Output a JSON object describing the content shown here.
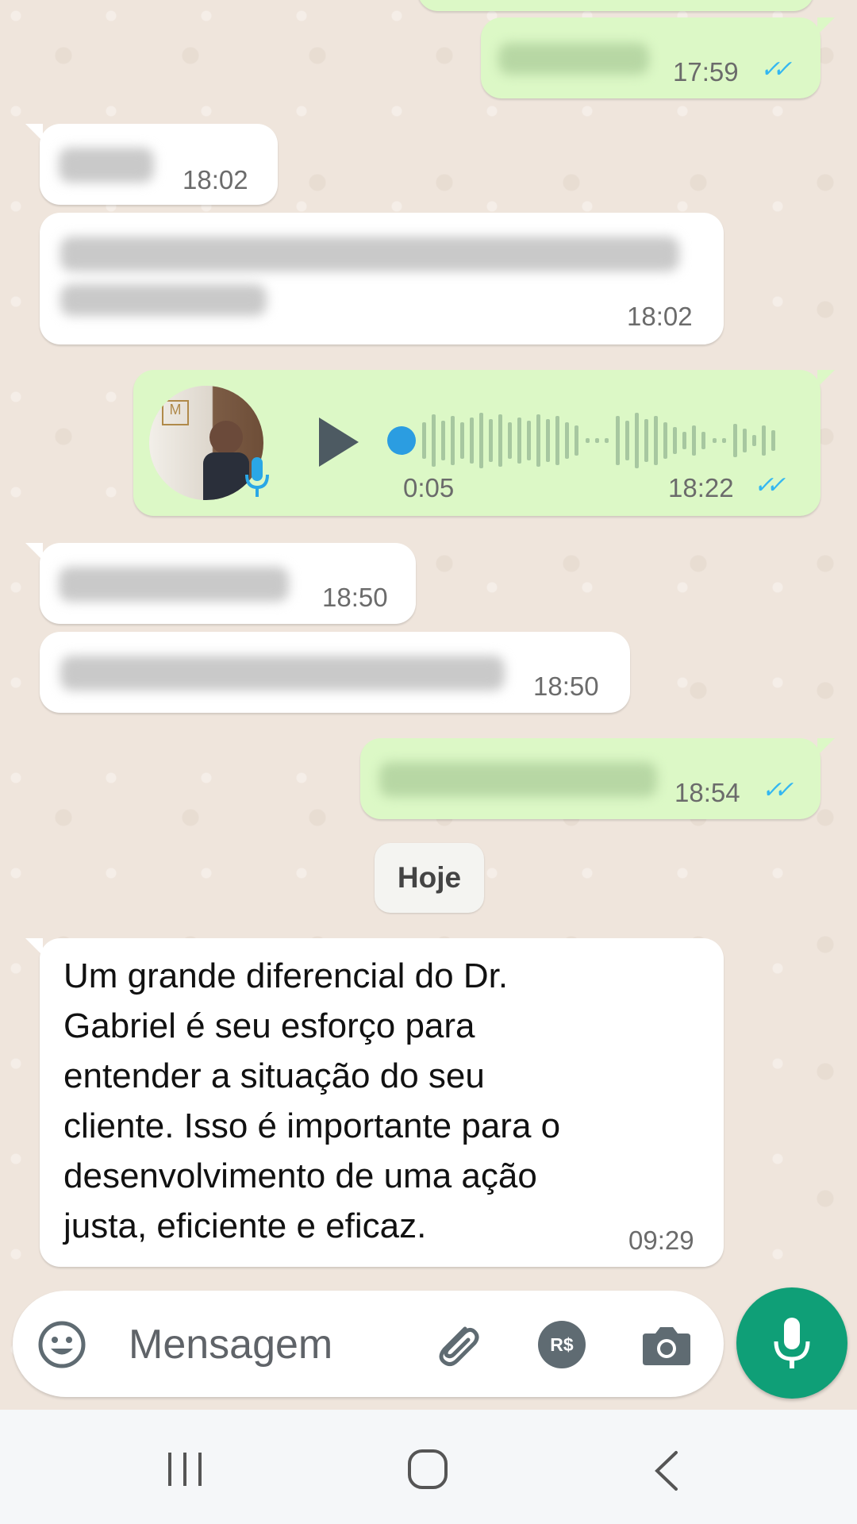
{
  "messages": [
    {
      "id": "m1",
      "dir": "out",
      "time": "17:59",
      "read": true
    },
    {
      "id": "m2",
      "dir": "in",
      "time": "18:02"
    },
    {
      "id": "m3",
      "dir": "in",
      "time": "18:02"
    },
    {
      "id": "m4",
      "dir": "out",
      "type": "voice",
      "duration": "0:05",
      "time": "18:22",
      "read": true
    },
    {
      "id": "m5",
      "dir": "in",
      "time": "18:50"
    },
    {
      "id": "m6",
      "dir": "in",
      "time": "18:50"
    },
    {
      "id": "m7",
      "dir": "out",
      "time": "18:54",
      "read": true
    },
    {
      "id": "m8",
      "dir": "in",
      "time": "09:29",
      "text": "Um grande diferencial do Dr.\nGabriel é seu esforço para\nentender a situação do seu\ncliente. Isso é importante para o\ndesenvolvimento de uma ação\njusta, eficiente e eficaz."
    }
  ],
  "date_separator": "Hoje",
  "composer": {
    "placeholder": "Mensagem",
    "icons": [
      "emoji-icon",
      "attach-icon",
      "payment-icon",
      "camera-icon"
    ],
    "payment_label": "R$"
  },
  "icons": {
    "read_receipt": "double-check-icon",
    "play": "play-icon",
    "mic": "mic-icon"
  },
  "colors": {
    "incoming": "#ffffff",
    "outgoing": "#dcf8c6",
    "read_tick": "#34b7f1",
    "accent": "#0f9f77"
  },
  "navbar": [
    "recent-apps-icon",
    "home-icon",
    "back-icon"
  ]
}
